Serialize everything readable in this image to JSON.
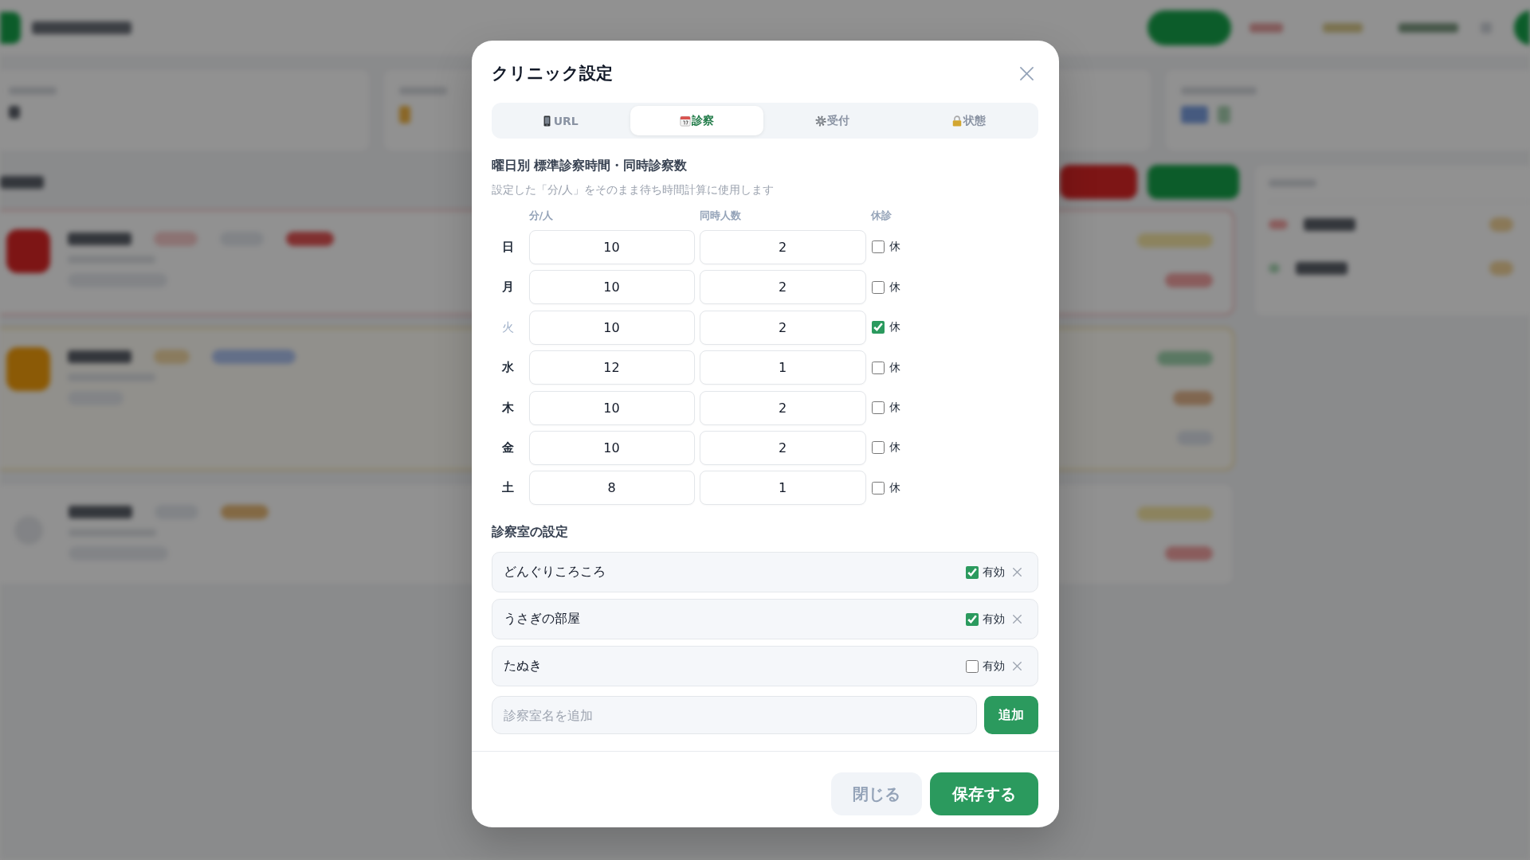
{
  "dialog": {
    "title": "クリニック設定"
  },
  "tabs": [
    {
      "label": "URL",
      "selected": false
    },
    {
      "label": "診察",
      "selected": true
    },
    {
      "label": "受付",
      "selected": false
    },
    {
      "label": "状態",
      "selected": false
    }
  ],
  "schedule": {
    "title": "曜日別 標準診察時間・同時診察数",
    "note": "設定した「分/人」をそのまま待ち時間計算に使用します",
    "columns": [
      "分/人",
      "同時人数",
      "休診"
    ],
    "rows": [
      {
        "day": "日",
        "minutes": "10",
        "capacity": "2",
        "closed": false,
        "closed_label": "休"
      },
      {
        "day": "月",
        "minutes": "10",
        "capacity": "2",
        "closed": false,
        "closed_label": "休"
      },
      {
        "day": "火",
        "minutes": "10",
        "capacity": "2",
        "closed": true,
        "closed_label": "休"
      },
      {
        "day": "水",
        "minutes": "12",
        "capacity": "1",
        "closed": false,
        "closed_label": "休"
      },
      {
        "day": "木",
        "minutes": "10",
        "capacity": "2",
        "closed": false,
        "closed_label": "休"
      },
      {
        "day": "金",
        "minutes": "10",
        "capacity": "2",
        "closed": false,
        "closed_label": "休"
      },
      {
        "day": "土",
        "minutes": "8",
        "capacity": "1",
        "closed": false,
        "closed_label": "休"
      }
    ]
  },
  "rooms": {
    "title": "診察室の設定",
    "items": [
      {
        "name": "どんぐりころころ",
        "enabled": true,
        "enabled_label": "有効"
      },
      {
        "name": "うさぎの部屋",
        "enabled": true,
        "enabled_label": "有効"
      },
      {
        "name": "たぬき",
        "enabled": false,
        "enabled_label": "有効"
      }
    ],
    "add_field": {
      "placeholder": "診察室名を追加"
    },
    "add_button": "追加"
  },
  "footer": {
    "buttons": [
      {
        "label": "閉じる",
        "kind": "secondary"
      },
      {
        "label": "保存する",
        "kind": "primary"
      }
    ]
  }
}
